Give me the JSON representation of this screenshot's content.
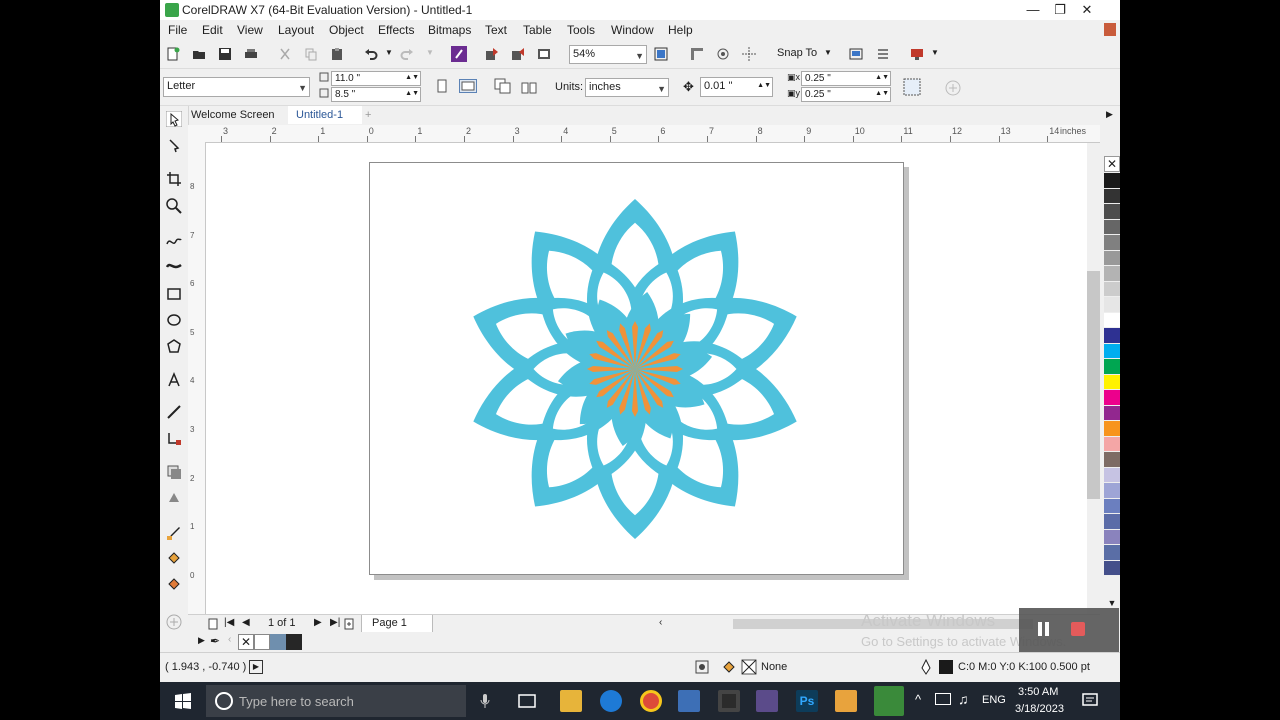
{
  "window": {
    "title": "CorelDRAW X7 (64-Bit Evaluation Version) - Untitled-1"
  },
  "menu": [
    "File",
    "Edit",
    "View",
    "Layout",
    "Object",
    "Effects",
    "Bitmaps",
    "Text",
    "Table",
    "Tools",
    "Window",
    "Help"
  ],
  "toolbar": {
    "zoom": "54%",
    "snap_label": "Snap To"
  },
  "property_bar": {
    "page_size": "Letter",
    "width": "11.0 \"",
    "height": "8.5 \"",
    "units_label": "Units:",
    "units": "inches",
    "nudge": "0.01 \"",
    "dup_x": "0.25 \"",
    "dup_y": "0.25 \""
  },
  "tabs": [
    "Welcome Screen",
    "Untitled-1"
  ],
  "ruler": {
    "h_ticks": [
      "3",
      "2",
      "1",
      "0",
      "1",
      "2",
      "3",
      "4",
      "5",
      "6",
      "7",
      "8",
      "9",
      "10",
      "11",
      "12",
      "13",
      "14"
    ],
    "unit": "inches",
    "v_ticks": [
      "8",
      "7",
      "6",
      "5",
      "4",
      "3",
      "2",
      "1",
      "0"
    ]
  },
  "page_nav": {
    "counter": "1 of 1",
    "page_tab": "Page 1"
  },
  "status": {
    "coords": "( 1.943 , -0.740 )",
    "fill": "None",
    "outline": "C:0 M:0 Y:0 K:100  0.500 pt"
  },
  "watermark": {
    "line1": "Activate Windows",
    "line2": "Go to Settings to activate Windows."
  },
  "taskbar": {
    "search_placeholder": "Type here to search",
    "lang": "ENG",
    "time": "3:50 AM",
    "date": "3/18/2023"
  },
  "palette": [
    "#1a1a1a",
    "#333333",
    "#4d4d4d",
    "#666666",
    "#808080",
    "#999999",
    "#b3b3b3",
    "#cccccc",
    "#e6e6e6",
    "#ffffff",
    "#2e3192",
    "#00aeef",
    "#00a651",
    "#fff200",
    "#ec008c",
    "#92278f",
    "#f7941d",
    "#f4a6a6",
    "#7d6b64",
    "#c6c3e3",
    "#9ea5d6",
    "#6b7fbf",
    "#5b6ca8",
    "#8a83bd",
    "#5a6ea6",
    "#444f8a"
  ],
  "artwork": {
    "inner_color": "#f0923a",
    "outer_color": "#4fc1dc"
  }
}
